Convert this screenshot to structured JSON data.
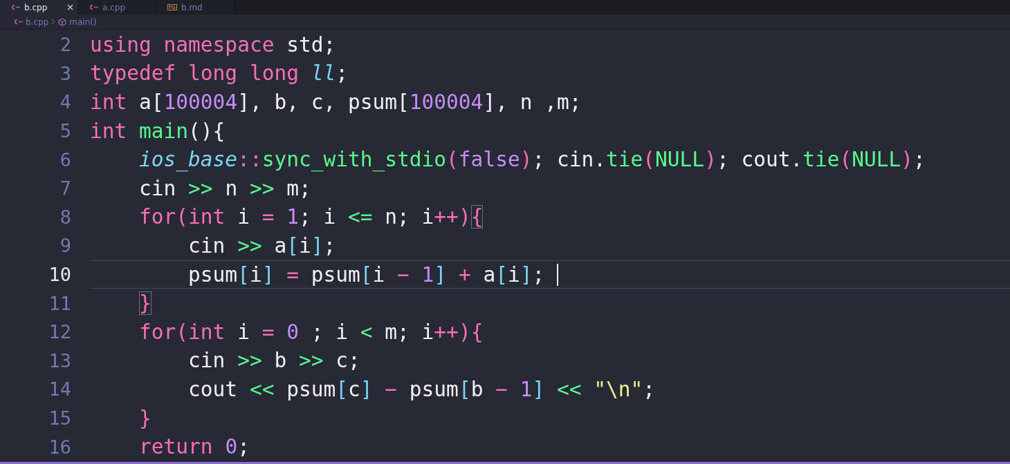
{
  "tabs": [
    {
      "label": "b.cpp",
      "kind": "cpp",
      "selected": true
    },
    {
      "label": "a.cpp",
      "kind": "cpp",
      "selected": false
    },
    {
      "label": "b.md",
      "kind": "md",
      "selected": false
    }
  ],
  "breadcrumb": [
    {
      "label": "b.cpp",
      "kind": "cpp"
    },
    {
      "label": "main()",
      "kind": "symbol"
    }
  ],
  "lines": [
    {
      "number": "2",
      "current": false,
      "tokens": [
        {
          "t": "using namespace ",
          "kind": "keyword"
        },
        {
          "t": "std;",
          "kind": "plain"
        }
      ]
    },
    {
      "number": "3",
      "current": false,
      "tokens": [
        {
          "t": "typedef long long ",
          "kind": "keyword"
        },
        {
          "t": "ll",
          "kind": "type"
        },
        {
          "t": ";",
          "kind": "plain"
        }
      ]
    },
    {
      "number": "4",
      "current": false,
      "tokens": [
        {
          "t": "int ",
          "kind": "keyword"
        },
        {
          "t": "a[",
          "kind": "plain"
        },
        {
          "t": "100004",
          "kind": "number"
        },
        {
          "t": "], b, c, psum[",
          "kind": "plain"
        },
        {
          "t": "100004",
          "kind": "number"
        },
        {
          "t": "], n ,m;",
          "kind": "plain"
        }
      ]
    },
    {
      "number": "5",
      "current": false,
      "tokens": [
        {
          "t": "int ",
          "kind": "keyword"
        },
        {
          "t": "main",
          "kind": "function"
        },
        {
          "t": "(){",
          "kind": "plain"
        }
      ]
    },
    {
      "number": "6",
      "current": false,
      "tokens": [
        {
          "t": "    ios_base",
          "kind": "type"
        },
        {
          "t": "::",
          "kind": "keyword"
        },
        {
          "t": "sync_with_stdio",
          "kind": "function"
        },
        {
          "t": "(",
          "kind": "keyword"
        },
        {
          "t": "false",
          "kind": "number"
        },
        {
          "t": ")",
          "kind": "keyword"
        },
        {
          "t": "; cin.",
          "kind": "plain"
        },
        {
          "t": "tie",
          "kind": "function"
        },
        {
          "t": "(",
          "kind": "keyword"
        },
        {
          "t": "NULL",
          "kind": "function"
        },
        {
          "t": ")",
          "kind": "keyword"
        },
        {
          "t": "; cout.",
          "kind": "plain"
        },
        {
          "t": "tie",
          "kind": "function"
        },
        {
          "t": "(",
          "kind": "keyword"
        },
        {
          "t": "NULL",
          "kind": "function"
        },
        {
          "t": ")",
          "kind": "keyword"
        },
        {
          "t": ";",
          "kind": "plain"
        }
      ]
    },
    {
      "number": "7",
      "current": false,
      "tokens": [
        {
          "t": "    cin ",
          "kind": "plain"
        },
        {
          "t": ">>",
          "kind": "operator"
        },
        {
          "t": " n ",
          "kind": "plain"
        },
        {
          "t": ">>",
          "kind": "operator"
        },
        {
          "t": " m;",
          "kind": "plain"
        }
      ]
    },
    {
      "number": "8",
      "current": false,
      "tokens": [
        {
          "t": "    for(int",
          "kind": "keyword"
        },
        {
          "t": " i ",
          "kind": "plain"
        },
        {
          "t": "= ",
          "kind": "keyword"
        },
        {
          "t": "1",
          "kind": "number"
        },
        {
          "t": "; i ",
          "kind": "plain"
        },
        {
          "t": "<=",
          "kind": "operator"
        },
        {
          "t": " n; i",
          "kind": "plain"
        },
        {
          "t": "++)",
          "kind": "keyword"
        },
        {
          "t": "{",
          "kind": "brace",
          "match": true
        }
      ]
    },
    {
      "number": "9",
      "current": false,
      "tokens": [
        {
          "t": "        cin ",
          "kind": "plain"
        },
        {
          "t": ">>",
          "kind": "operator"
        },
        {
          "t": " a",
          "kind": "plain"
        },
        {
          "t": "[",
          "kind": "bracket"
        },
        {
          "t": "i",
          "kind": "plain"
        },
        {
          "t": "]",
          "kind": "bracket"
        },
        {
          "t": ";",
          "kind": "plain"
        }
      ]
    },
    {
      "number": "10",
      "current": true,
      "tokens": [
        {
          "t": "        psum",
          "kind": "plain"
        },
        {
          "t": "[",
          "kind": "bracket"
        },
        {
          "t": "i",
          "kind": "plain"
        },
        {
          "t": "] ",
          "kind": "bracket"
        },
        {
          "t": "= ",
          "kind": "keyword"
        },
        {
          "t": "psum",
          "kind": "plain"
        },
        {
          "t": "[",
          "kind": "bracket"
        },
        {
          "t": "i ",
          "kind": "plain"
        },
        {
          "t": "− ",
          "kind": "keyword"
        },
        {
          "t": "1",
          "kind": "number"
        },
        {
          "t": "] ",
          "kind": "bracket"
        },
        {
          "t": "+ ",
          "kind": "keyword"
        },
        {
          "t": "a",
          "kind": "plain"
        },
        {
          "t": "[",
          "kind": "bracket"
        },
        {
          "t": "i",
          "kind": "plain"
        },
        {
          "t": "]",
          "kind": "bracket"
        },
        {
          "t": "; ",
          "kind": "plain"
        }
      ]
    },
    {
      "number": "11",
      "current": false,
      "tokens": [
        {
          "t": "    }",
          "kind": "brace",
          "match": true
        }
      ]
    },
    {
      "number": "12",
      "current": false,
      "tokens": [
        {
          "t": "    for(int",
          "kind": "keyword"
        },
        {
          "t": " i ",
          "kind": "plain"
        },
        {
          "t": "= ",
          "kind": "keyword"
        },
        {
          "t": "0",
          "kind": "number"
        },
        {
          "t": " ; i ",
          "kind": "plain"
        },
        {
          "t": "<",
          "kind": "operator"
        },
        {
          "t": " m; i",
          "kind": "plain"
        },
        {
          "t": "++){",
          "kind": "keyword"
        }
      ]
    },
    {
      "number": "13",
      "current": false,
      "tokens": [
        {
          "t": "        cin ",
          "kind": "plain"
        },
        {
          "t": ">>",
          "kind": "operator"
        },
        {
          "t": " b ",
          "kind": "plain"
        },
        {
          "t": ">>",
          "kind": "operator"
        },
        {
          "t": " c;",
          "kind": "plain"
        }
      ]
    },
    {
      "number": "14",
      "current": false,
      "tokens": [
        {
          "t": "        cout ",
          "kind": "plain"
        },
        {
          "t": "<<",
          "kind": "operator"
        },
        {
          "t": " psum",
          "kind": "plain"
        },
        {
          "t": "[",
          "kind": "bracket"
        },
        {
          "t": "c",
          "kind": "plain"
        },
        {
          "t": "] ",
          "kind": "bracket"
        },
        {
          "t": "− ",
          "kind": "keyword"
        },
        {
          "t": "psum",
          "kind": "plain"
        },
        {
          "t": "[",
          "kind": "bracket"
        },
        {
          "t": "b ",
          "kind": "plain"
        },
        {
          "t": "− ",
          "kind": "keyword"
        },
        {
          "t": "1",
          "kind": "number"
        },
        {
          "t": "] ",
          "kind": "bracket"
        },
        {
          "t": "<<",
          "kind": "operator"
        },
        {
          "t": " \"\\n\"",
          "kind": "string"
        },
        {
          "t": ";",
          "kind": "plain"
        }
      ]
    },
    {
      "number": "15",
      "current": false,
      "tokens": [
        {
          "t": "    }",
          "kind": "keyword"
        }
      ]
    },
    {
      "number": "16",
      "current": false,
      "tokens": [
        {
          "t": "    return ",
          "kind": "keyword"
        },
        {
          "t": "0",
          "kind": "number"
        },
        {
          "t": ";",
          "kind": "plain"
        }
      ]
    }
  ]
}
